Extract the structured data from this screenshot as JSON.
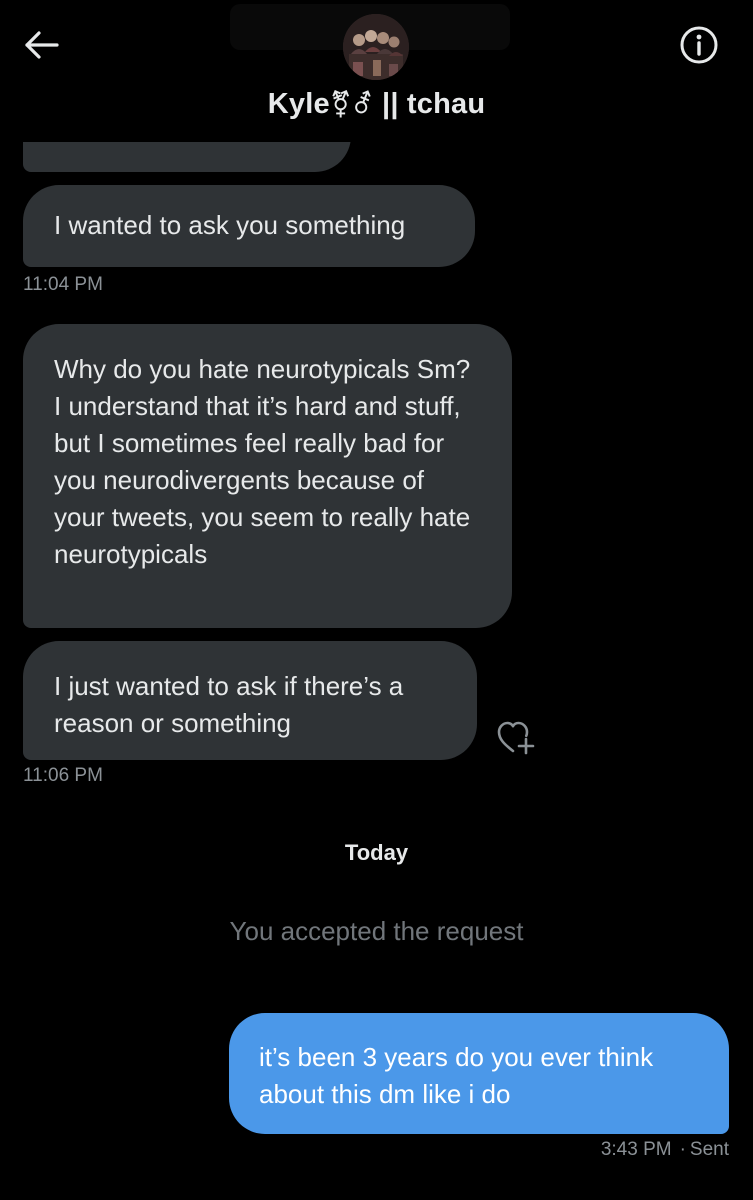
{
  "header": {
    "title_name": "Kyle",
    "title_symbols": "⚧⚦",
    "title_suffix": " || tchau",
    "back_icon": "arrow-left-icon",
    "info_icon": "info-circle-icon"
  },
  "messages": {
    "received": [
      {
        "text": "I wanted to ask you something"
      },
      {
        "text": "Why do you hate neurotypicals Sm? I understand that it’s hard and stuff, but I sometimes feel really bad for you neurodivergents because of your tweets, you seem to really hate neurotypicals"
      },
      {
        "text": "I just wanted to ask if there’s a reason or something"
      }
    ],
    "timestamps": [
      "11:04 PM",
      "11:06 PM"
    ],
    "day_divider": "Today",
    "system": "You accepted the request",
    "sent": {
      "text": "it’s been 3 years do you ever think about this dm like i do",
      "time": "3:43 PM",
      "separator": "·",
      "status": "Sent"
    }
  },
  "colors": {
    "background": "#000000",
    "received_bubble": "#2f3336",
    "sent_bubble": "#4b98e9",
    "timestamp_text": "#8b9196",
    "system_text": "#71767b"
  }
}
